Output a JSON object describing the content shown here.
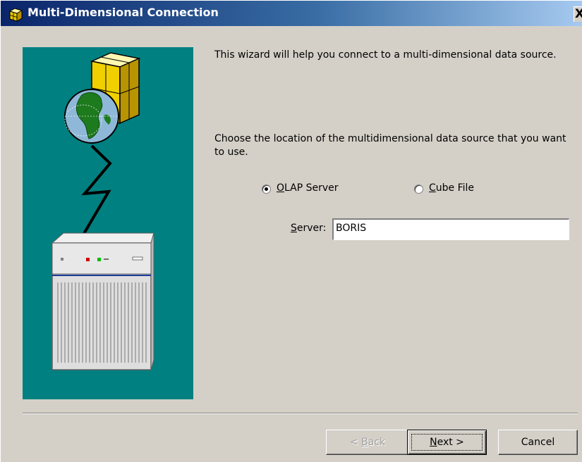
{
  "window": {
    "title": "Multi-Dimensional Connection",
    "close_label": "X"
  },
  "intro_text": "This wizard will help you connect to a multi-dimensional data source.",
  "choose_text": "Choose the location of the multidimensional data source that you want to use.",
  "location": {
    "options": [
      {
        "label": "OLAP Server",
        "accel": "O",
        "rest": "LAP Server",
        "selected": true
      },
      {
        "label": "Cube File",
        "accel": "C",
        "rest": "ube File",
        "selected": false
      }
    ]
  },
  "server": {
    "label": "Server:",
    "label_accel": "S",
    "label_rest": "erver:",
    "value": "BORIS"
  },
  "buttons": {
    "back_prefix": "< ",
    "back_accel": "B",
    "back_rest": "ack",
    "next_accel": "N",
    "next_rest": "ext >",
    "cancel": "Cancel"
  },
  "colors": {
    "title_gradient_start": "#0a246a",
    "title_gradient_end": "#a6caf0",
    "dialog_bg": "#d4d0c8",
    "illustration_bg": "#008080"
  }
}
